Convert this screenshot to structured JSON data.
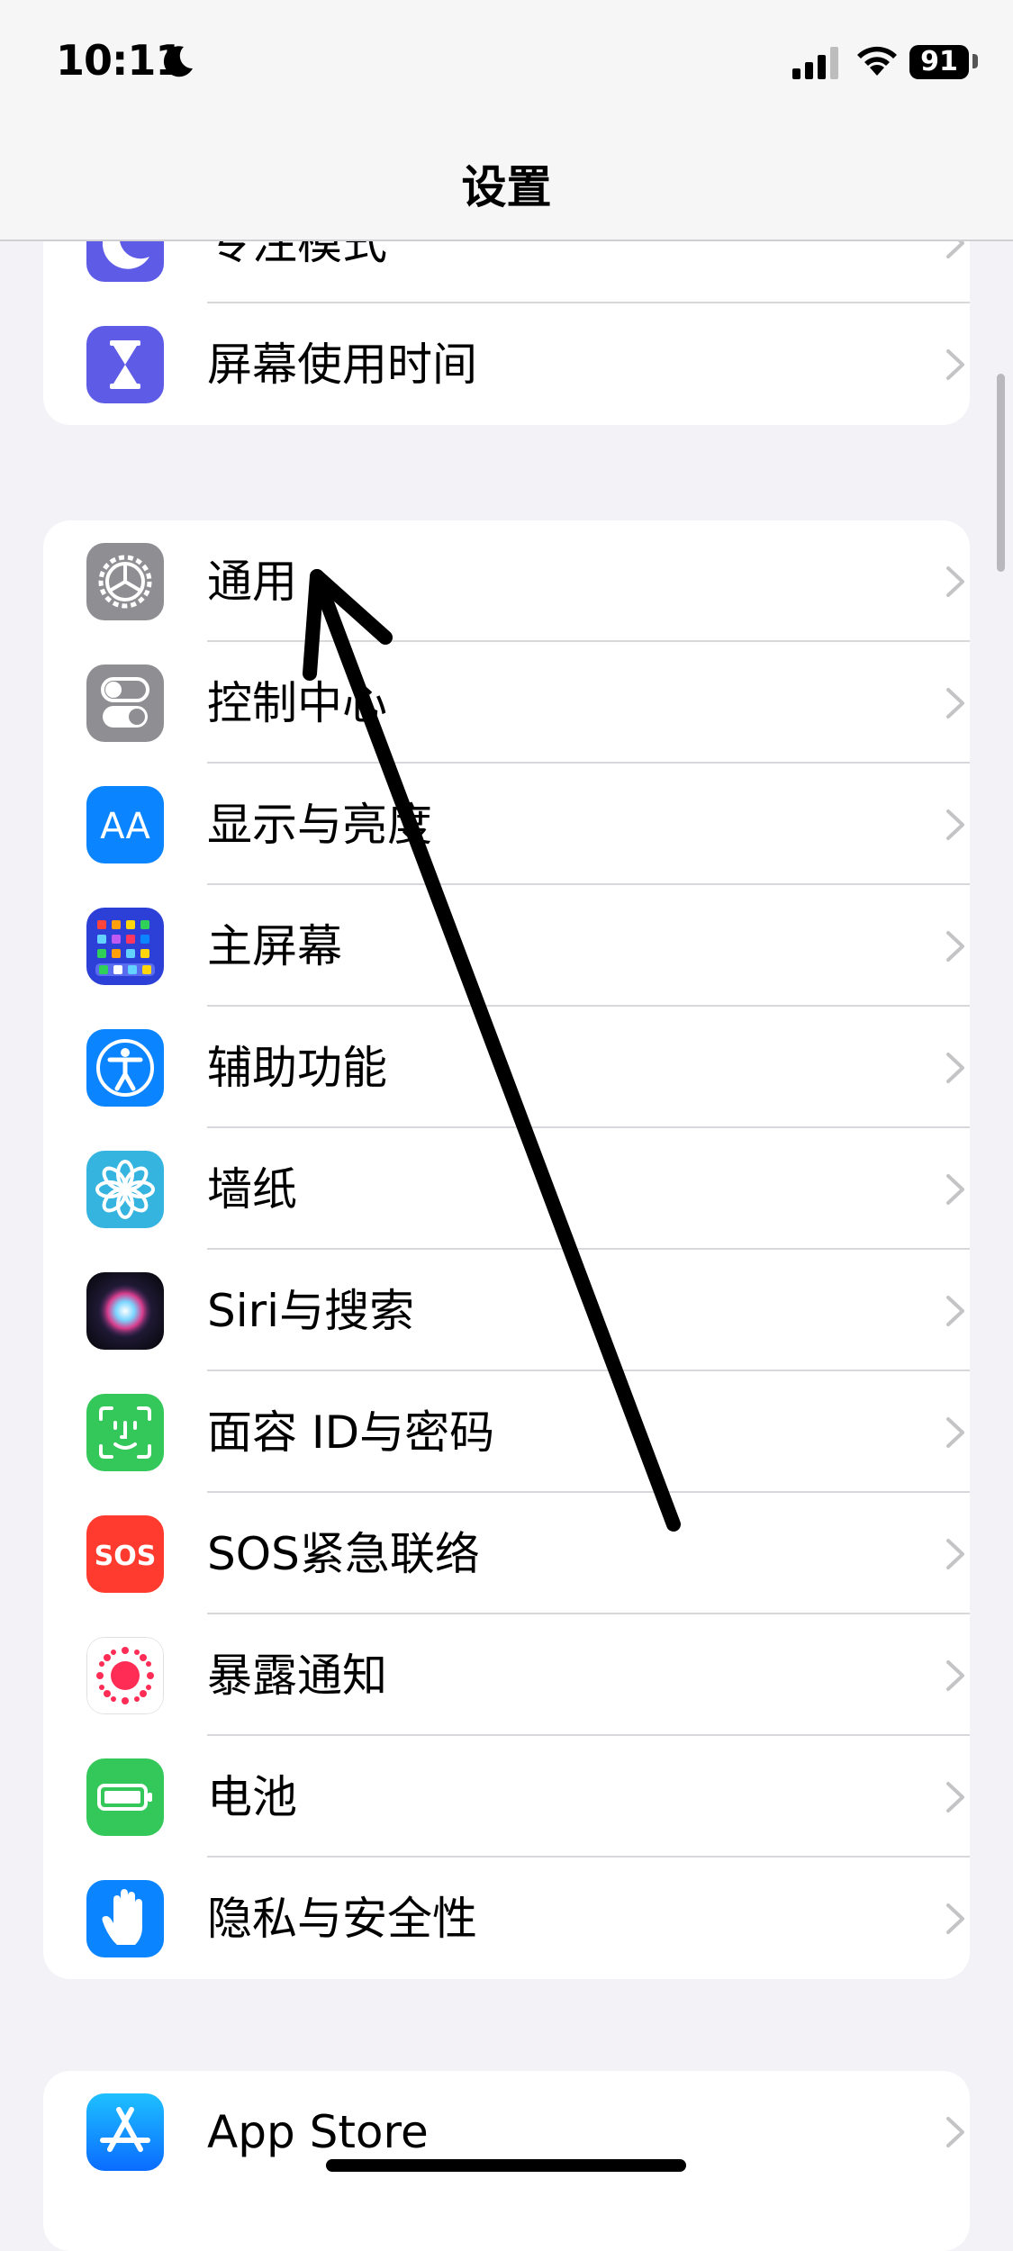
{
  "status": {
    "time": "10:11",
    "battery": "91"
  },
  "nav": {
    "title": "设置"
  },
  "groups": [
    {
      "rows": [
        {
          "label": "专注模式",
          "icon": "moon-icon"
        },
        {
          "label": "屏幕使用时间",
          "icon": "hourglass-icon"
        }
      ]
    },
    {
      "rows": [
        {
          "label": "通用",
          "icon": "gear-icon"
        },
        {
          "label": "控制中心",
          "icon": "toggle-icon"
        },
        {
          "label": "显示与亮度",
          "icon": "text-size-icon"
        },
        {
          "label": "主屏幕",
          "icon": "app-grid-icon"
        },
        {
          "label": "辅助功能",
          "icon": "accessibility-icon"
        },
        {
          "label": "墙纸",
          "icon": "flower-icon"
        },
        {
          "label": "Siri与搜索",
          "icon": "siri-icon"
        },
        {
          "label": "面容 ID与密码",
          "icon": "face-id-icon"
        },
        {
          "label": "SOS紧急联络",
          "icon": "sos-icon"
        },
        {
          "label": "暴露通知",
          "icon": "exposure-icon"
        },
        {
          "label": "电池",
          "icon": "battery-icon"
        },
        {
          "label": "隐私与安全性",
          "icon": "hand-icon"
        }
      ]
    },
    {
      "rows": [
        {
          "label": "App Store",
          "icon": "app-store-icon"
        }
      ]
    }
  ],
  "icons": {
    "sos_text": "SOS",
    "text_size_text": "AA"
  },
  "colors": {
    "focus": "#5e5ce6",
    "screen_time": "#5e5ce6",
    "general": "#8e8e93",
    "control_center": "#8e8e93",
    "display": "#0a84ff",
    "home_screen": "#2c40d8",
    "accessibility": "#0a84ff",
    "wallpaper": "#36b4e0",
    "face_id": "#34c759",
    "sos": "#ff3b30",
    "exposure": "#ff2d55",
    "battery": "#34c759",
    "privacy": "#0a84ff",
    "app_store": "#0a84ff"
  }
}
